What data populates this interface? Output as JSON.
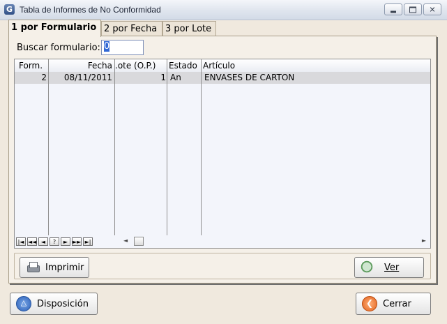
{
  "window": {
    "title": "Tabla de Informes de No Conformidad",
    "app_icon": "G"
  },
  "tabs": [
    {
      "label": "1 por Formulario",
      "active": true
    },
    {
      "label": "2 por Fecha",
      "active": false
    },
    {
      "label": "3 por Lote",
      "active": false
    }
  ],
  "search": {
    "label": "Buscar formulario:",
    "value": "0"
  },
  "grid": {
    "columns": [
      "Form.",
      "Fecha",
      ".ote (O.P.)",
      "Estado",
      "Artículo"
    ],
    "rows": [
      {
        "form": "2",
        "fecha": "08/11/2011",
        "lote": "1",
        "estado": "An",
        "articulo": "ENVASES DE CARTON"
      }
    ],
    "nav_buttons": [
      "|◄",
      "◄◄",
      "◄",
      "?",
      "►",
      "►►",
      "►|"
    ]
  },
  "buttons": {
    "imprimir": "Imprimir",
    "ver": "Ver",
    "disposicion": "Disposición",
    "cerrar": "Cerrar"
  },
  "icons": {
    "app": "app-logo-icon",
    "print": "printer-icon",
    "view": "magnifier-icon",
    "disposition": "triangle-icon",
    "close": "back-arrow-icon"
  }
}
